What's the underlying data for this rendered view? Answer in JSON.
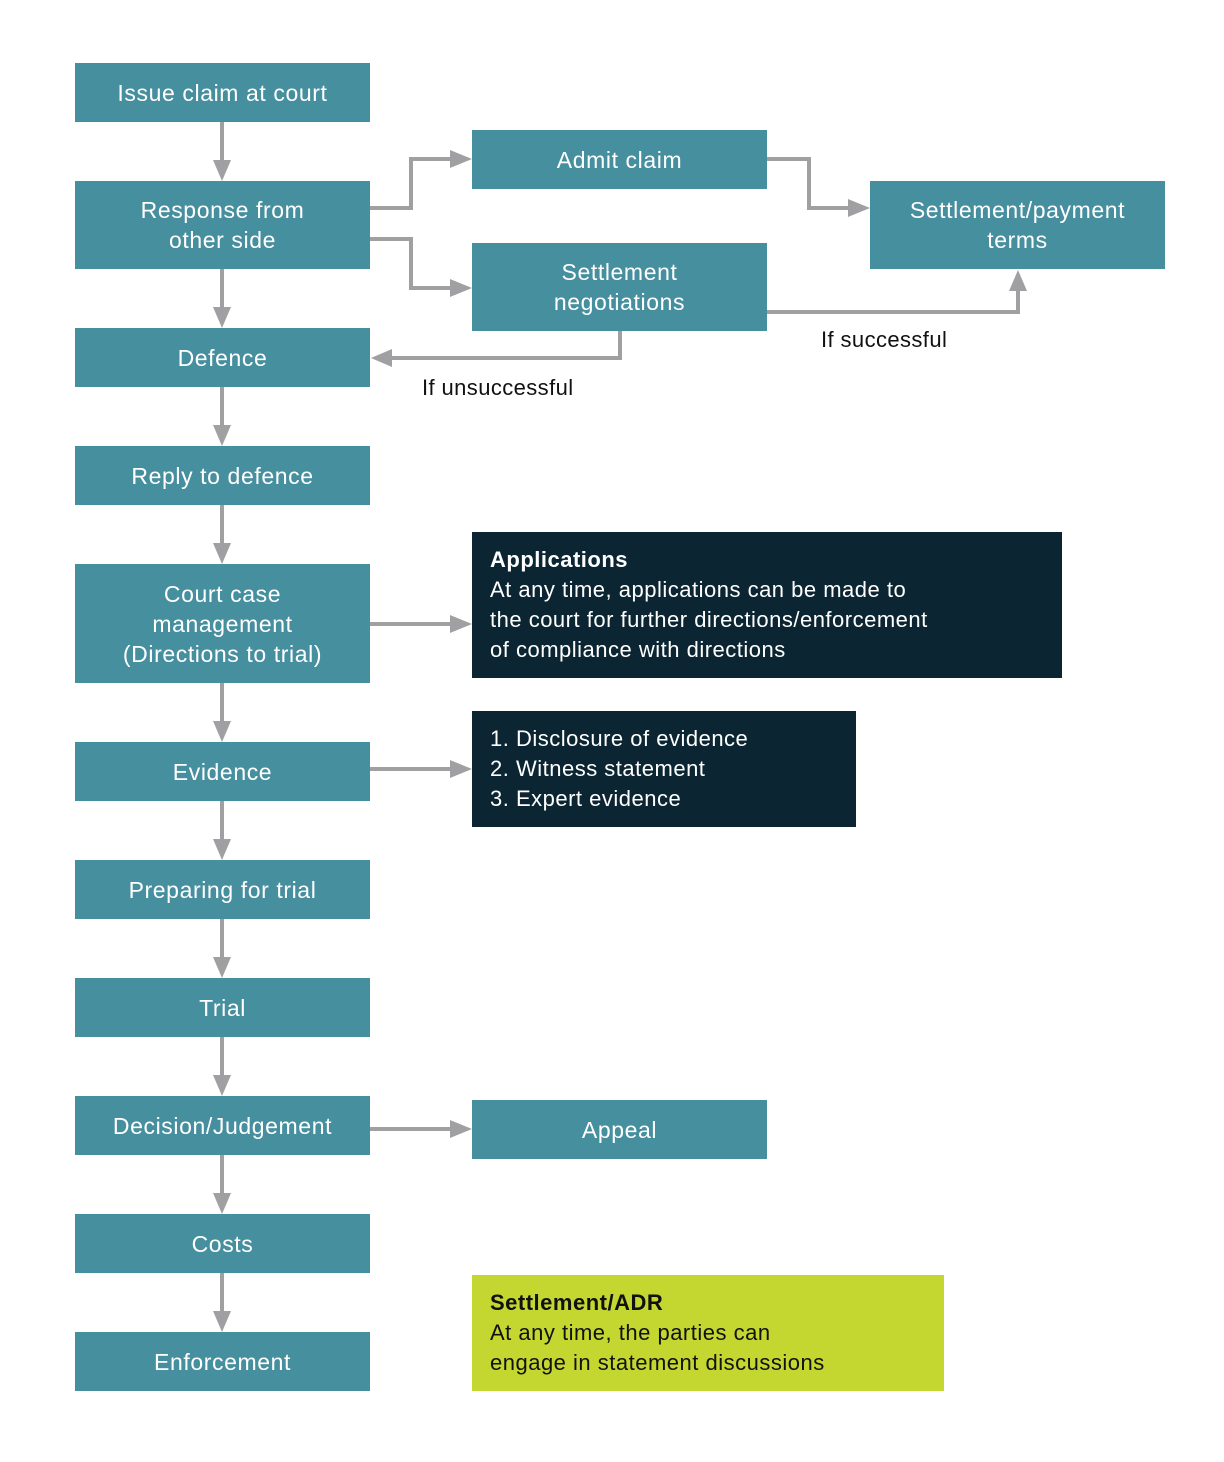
{
  "diagram": {
    "colors": {
      "step": "#468f9f",
      "info_dark": "#0b2532",
      "info_lime": "#c4d630",
      "connector": "#a0a0a2"
    },
    "main_steps": [
      {
        "id": "issue",
        "lines": [
          "Issue claim at court"
        ]
      },
      {
        "id": "response",
        "lines": [
          "Response from",
          "other side"
        ]
      },
      {
        "id": "defence",
        "lines": [
          "Defence"
        ]
      },
      {
        "id": "reply",
        "lines": [
          "Reply to defence"
        ]
      },
      {
        "id": "case-management",
        "lines": [
          "Court case",
          "management",
          "(Directions to trial)"
        ]
      },
      {
        "id": "evidence",
        "lines": [
          "Evidence"
        ]
      },
      {
        "id": "preparing",
        "lines": [
          "Preparing for trial"
        ]
      },
      {
        "id": "trial",
        "lines": [
          "Trial"
        ]
      },
      {
        "id": "decision",
        "lines": [
          "Decision/Judgement"
        ]
      },
      {
        "id": "costs",
        "lines": [
          "Costs"
        ]
      },
      {
        "id": "enforcement",
        "lines": [
          "Enforcement"
        ]
      }
    ],
    "side_steps": {
      "admit": {
        "lines": [
          "Admit claim"
        ]
      },
      "negotiations": {
        "lines": [
          "Settlement",
          "negotiations"
        ]
      },
      "settlement_terms": {
        "lines": [
          "Settlement/payment",
          "terms"
        ]
      },
      "appeal": {
        "lines": [
          "Appeal"
        ]
      }
    },
    "info_boxes": {
      "applications": {
        "title": "Applications",
        "lines": [
          "At any time, applications can be made to",
          "the court for further directions/enforcement",
          "of compliance with directions"
        ]
      },
      "evidence_list": {
        "lines": [
          "1. Disclosure of evidence",
          "2. Witness statement",
          "3. Expert evidence"
        ]
      },
      "settlement_adr": {
        "title": "Settlement/ADR",
        "lines": [
          "At any time, the parties can",
          "engage in statement discussions"
        ]
      }
    },
    "edge_labels": {
      "if_unsuccessful": "If unsuccessful",
      "if_successful": "If successful"
    },
    "edges": [
      {
        "from": "issue",
        "to": "response"
      },
      {
        "from": "response",
        "to": "admit"
      },
      {
        "from": "response",
        "to": "negotiations"
      },
      {
        "from": "admit",
        "to": "settlement_terms"
      },
      {
        "from": "negotiations",
        "to": "settlement_terms",
        "label": "If successful"
      },
      {
        "from": "negotiations",
        "to": "defence",
        "label": "If unsuccessful"
      },
      {
        "from": "response",
        "to": "defence"
      },
      {
        "from": "defence",
        "to": "reply"
      },
      {
        "from": "reply",
        "to": "case-management"
      },
      {
        "from": "case-management",
        "to": "applications"
      },
      {
        "from": "case-management",
        "to": "evidence"
      },
      {
        "from": "evidence",
        "to": "evidence_list"
      },
      {
        "from": "evidence",
        "to": "preparing"
      },
      {
        "from": "preparing",
        "to": "trial"
      },
      {
        "from": "trial",
        "to": "decision"
      },
      {
        "from": "decision",
        "to": "appeal"
      },
      {
        "from": "decision",
        "to": "costs"
      },
      {
        "from": "costs",
        "to": "enforcement"
      }
    ]
  }
}
